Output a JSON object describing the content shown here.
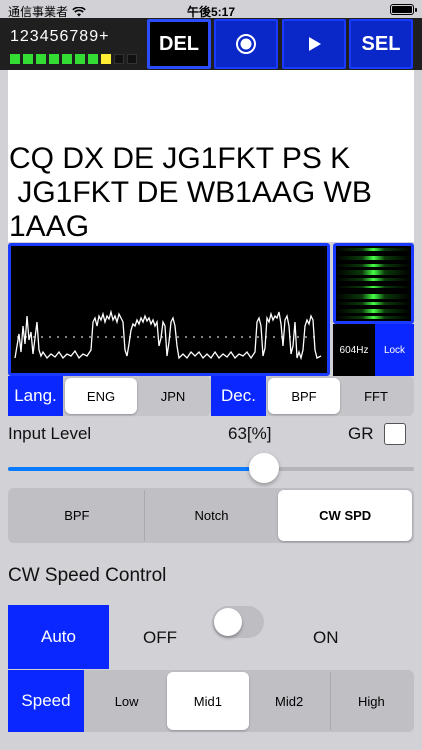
{
  "status_bar": {
    "carrier": "通信事業者",
    "time": "午後5:17"
  },
  "top_panel": {
    "digits": "123456789+",
    "level_leds": [
      "green",
      "green",
      "green",
      "green",
      "green",
      "green",
      "green",
      "yellow",
      "off",
      "off"
    ],
    "buttons": {
      "del": "DEL",
      "record_icon": "record-icon",
      "play_icon": "play-icon",
      "sel": "SEL"
    }
  },
  "decoded_text": {
    "lines": [
      "CQ DX DE JG1FKT PS K",
      " JG1FKT DE WB1AAG WB",
      "1AAG"
    ]
  },
  "spectrum": {
    "frequency": "604Hz",
    "lock_label": "Lock"
  },
  "lang_row": {
    "label": "Lang.",
    "options": [
      "ENG",
      "JPN"
    ],
    "selected": "ENG"
  },
  "dec_row": {
    "label": "Dec.",
    "options": [
      "BPF",
      "FFT"
    ],
    "selected": "BPF"
  },
  "input_level": {
    "label": "Input Level",
    "value": "63[%]",
    "percent": 63,
    "gr_label": "GR",
    "gr_checked": false
  },
  "filter_tabs": {
    "options": [
      "BPF",
      "Notch",
      "CW SPD"
    ],
    "selected": "CW SPD"
  },
  "cw_speed": {
    "title": "CW Speed Control",
    "auto_label": "Auto",
    "off_label": "OFF",
    "on_label": "ON",
    "toggle_on": false
  },
  "speed_row": {
    "label": "Speed",
    "options": [
      "Low",
      "Mid1",
      "Mid2",
      "High"
    ],
    "selected": "Mid1"
  },
  "colors": {
    "accent_blue": "#0a27ff",
    "led_green": "#33dd33",
    "led_yellow": "#ffee33"
  }
}
